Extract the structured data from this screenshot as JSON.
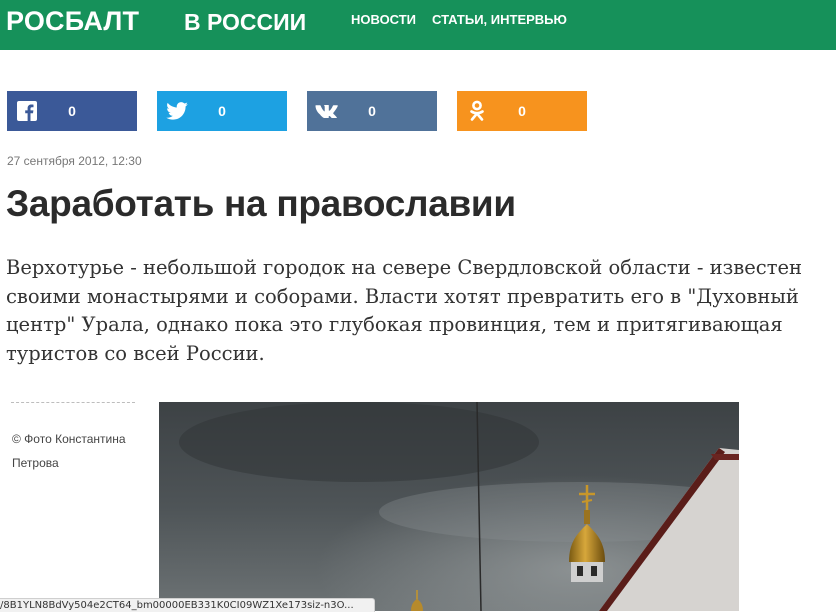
{
  "header": {
    "logo": "РОСБАЛТ",
    "section": "В РОССИИ",
    "nav": [
      "НОВОСТИ",
      "СТАТЬИ, ИНТЕРВЬЮ"
    ],
    "background": "#16915a"
  },
  "share": {
    "facebook": {
      "icon": "facebook-icon",
      "count": "0",
      "color": "#3b5998"
    },
    "twitter": {
      "icon": "twitter-icon",
      "count": "0",
      "color": "#1da1e2"
    },
    "vk": {
      "icon": "vk-icon",
      "count": "0",
      "color": "#507299"
    },
    "ok": {
      "icon": "odnoklassniki-icon",
      "count": "0",
      "color": "#f7931e"
    }
  },
  "article": {
    "date": "27 сентября 2012, 12:30",
    "title": "Заработать на православии",
    "lead": "Верхотурье - небольшой городок на севере Свердловской области - известен своими монастырями и соборами. Власти хотят превратить его в \"Духовный центр\" Урала, однако пока это глубокая провинция, тем и притягивающая туристов со всей России.",
    "photo_credit": "© Фото Константина Петрова"
  },
  "statusbar": {
    "url": "/8B1YLN8BdVy504e2CT64_bm00000EB331K0CI09WZ1Xe173siz-n3O..."
  }
}
